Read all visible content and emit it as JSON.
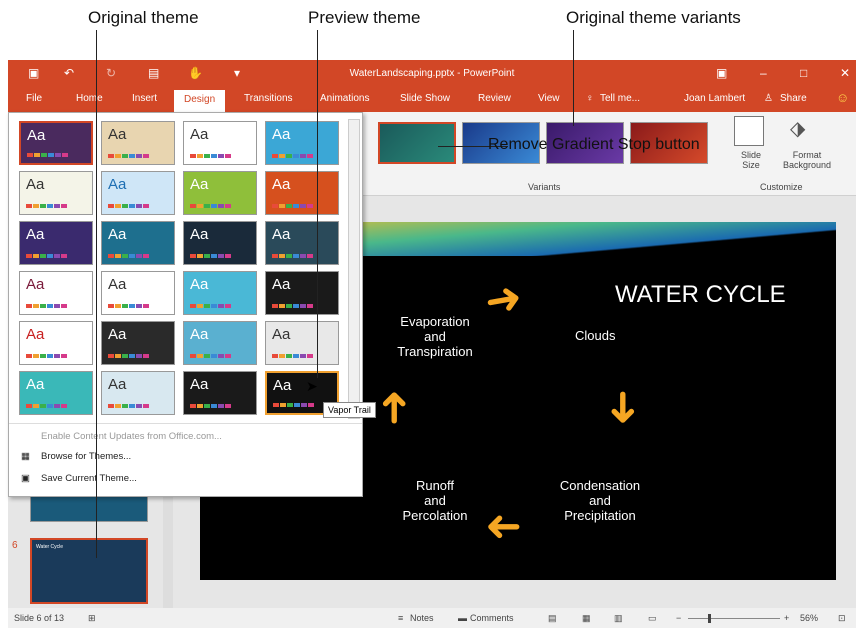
{
  "callouts": {
    "original_theme": "Original theme",
    "preview_theme": "Preview theme",
    "original_variants": "Original theme variants",
    "remove_gradient": "Remove Gradient Stop button"
  },
  "window": {
    "title": "WaterLandscaping.pptx - PowerPoint",
    "user": "Joan Lambert",
    "share": "Share",
    "tell_me": "Tell me..."
  },
  "tabs": [
    "File",
    "Home",
    "Insert",
    "Design",
    "Transitions",
    "Animations",
    "Slide Show",
    "Review",
    "View"
  ],
  "ribbon": {
    "variants_label": "Variants",
    "customize_label": "Customize",
    "slide_size": "Slide Size",
    "format_background": "Format Background"
  },
  "gallery": {
    "aa": "Aa",
    "menu_enable": "Enable Content Updates from Office.com...",
    "menu_browse": "Browse for Themes...",
    "menu_save": "Save Current Theme...",
    "tooltip": "Vapor Trail"
  },
  "thumbs": [
    {
      "bg": "#4a2a5e",
      "fg": "#fff"
    },
    {
      "bg": "#e8d5b0",
      "fg": "#333"
    },
    {
      "bg": "#ffffff",
      "fg": "#333"
    },
    {
      "bg": "#3ba7d6",
      "fg": "#fff"
    },
    {
      "bg": "#f4f4e8",
      "fg": "#333"
    },
    {
      "bg": "#cfe6f7",
      "fg": "#1e6fb3"
    },
    {
      "bg": "#8fbf3a",
      "fg": "#fff"
    },
    {
      "bg": "#d6501e",
      "fg": "#fff"
    },
    {
      "bg": "#3a2a6e",
      "fg": "#fff"
    },
    {
      "bg": "#1e6f8e",
      "fg": "#fff"
    },
    {
      "bg": "#1a2a3a",
      "fg": "#fff"
    },
    {
      "bg": "#2a4a5a",
      "fg": "#fff"
    },
    {
      "bg": "#ffffff",
      "fg": "#7a1a3a"
    },
    {
      "bg": "#ffffff",
      "fg": "#333"
    },
    {
      "bg": "#4ab8d6",
      "fg": "#fff"
    },
    {
      "bg": "#1a1a1a",
      "fg": "#fff"
    },
    {
      "bg": "#ffffff",
      "fg": "#c82020"
    },
    {
      "bg": "#2a2a2a",
      "fg": "#fff"
    },
    {
      "bg": "#5ab0d0",
      "fg": "#fff"
    },
    {
      "bg": "#e8e8e8",
      "fg": "#333"
    },
    {
      "bg": "#3ab8b8",
      "fg": "#fff"
    },
    {
      "bg": "#d8e8f0",
      "fg": "#333"
    },
    {
      "bg": "#1a1a1a",
      "fg": "#fff"
    },
    {
      "bg": "#111111",
      "fg": "#fff"
    }
  ],
  "slide": {
    "title": "WATER CYCLE",
    "evap1": "Evaporation",
    "evap2": "and",
    "evap3": "Transpiration",
    "clouds": "Clouds",
    "cond1": "Condensation",
    "cond2": "and",
    "cond3": "Precipitation",
    "run1": "Runoff",
    "run2": "and",
    "run3": "Percolation"
  },
  "thumbnail": {
    "number": "6",
    "title": "Water Cycle"
  },
  "status": {
    "slide_of": "Slide 6 of 13",
    "notes": "Notes",
    "comments": "Comments",
    "zoom": "56%"
  },
  "colors": {
    "accent": "#d24726",
    "arrow": "#f5a623"
  }
}
